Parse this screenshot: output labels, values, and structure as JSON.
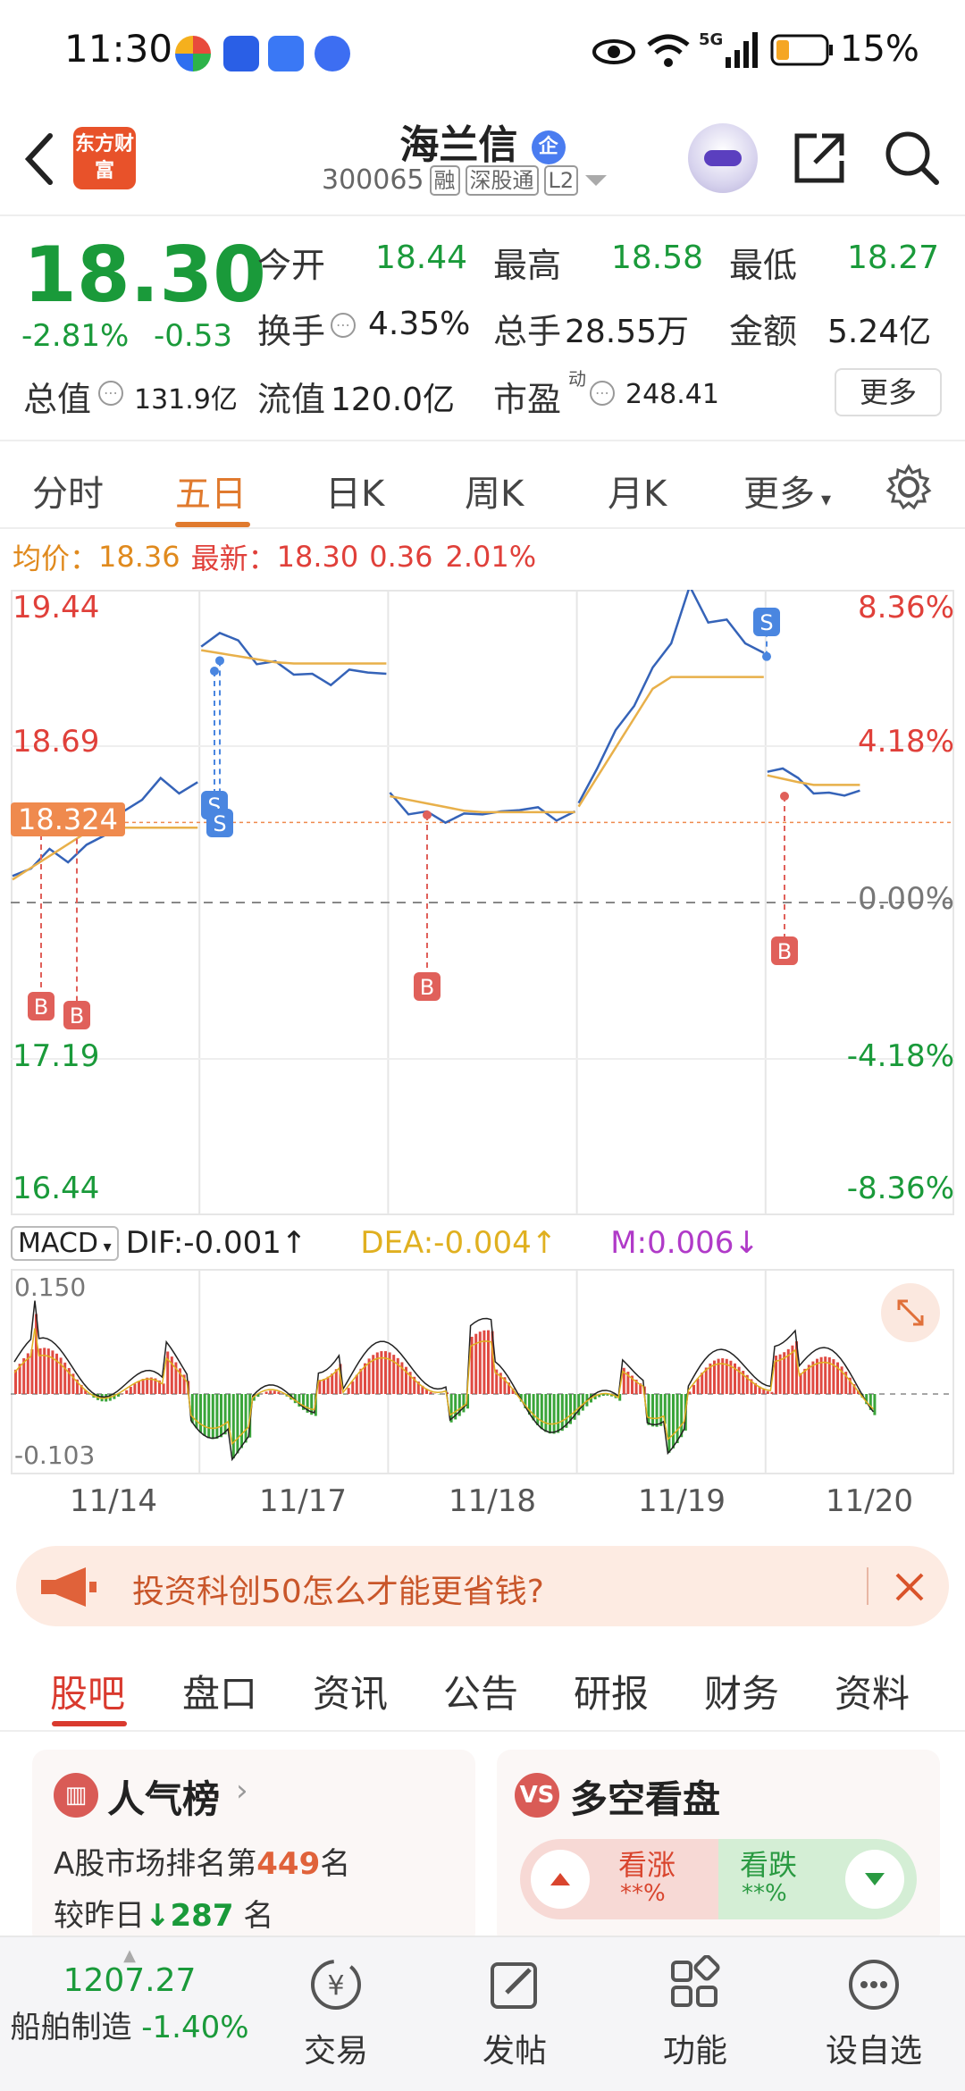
{
  "status_bar": {
    "time": "11:30",
    "signal": "5G",
    "battery": "15%"
  },
  "header": {
    "logo_text": "东方财富",
    "name": "海兰信",
    "badge": "企",
    "code": "300065",
    "tags": [
      "融",
      "深股通",
      "L2"
    ]
  },
  "quote": {
    "price": "18.30",
    "change_pct": "-2.81%",
    "change_amt": "-0.53",
    "open_label": "今开",
    "open": "18.44",
    "high_label": "最高",
    "high": "18.58",
    "low_label": "最低",
    "low": "18.27",
    "turnover_label": "换手",
    "turnover": "4.35%",
    "volume_label": "总手",
    "volume": "28.55万",
    "amount_label": "金额",
    "amount": "5.24亿",
    "mktcap_label": "总值",
    "mktcap": "131.9亿",
    "float_label": "流值",
    "float": "120.0亿",
    "pe_label": "市盈",
    "pe_sup": "动",
    "pe": "248.41",
    "more_label": "更多"
  },
  "chart_tabs": [
    "分时",
    "五日",
    "日K",
    "周K",
    "月K",
    "更多"
  ],
  "avg_line": {
    "avg_label": "均价：",
    "avg": "18.36",
    "latest_label": "最新：",
    "latest": "18.30",
    "diff": "0.36",
    "pct": "2.01%"
  },
  "chart_data": {
    "type": "line",
    "title": "",
    "y_left_ticks": [
      "19.44",
      "18.69",
      "17.19",
      "16.44"
    ],
    "y_right_ticks": [
      "8.36%",
      "4.18%",
      "0.00%",
      "-4.18%",
      "-8.36%"
    ],
    "current_marker": "18.324",
    "ylim": [
      16.44,
      19.44
    ],
    "x_days": [
      "11/14",
      "11/17",
      "11/18",
      "11/19",
      "11/20"
    ],
    "series": [
      {
        "values": [
          18.05,
          18.12,
          18.18,
          18.15,
          18.2,
          18.28,
          18.36,
          18.45,
          18.52,
          18.48,
          18.5,
          19.15,
          19.25,
          19.18,
          19.1,
          19.08,
          19.05,
          19.02,
          19.0,
          19.04,
          19.06,
          19.02,
          18.45,
          18.38,
          18.36,
          18.34,
          18.35,
          18.38,
          18.36,
          18.4,
          18.38,
          18.35,
          18.36,
          18.4,
          18.6,
          18.75,
          18.9,
          19.05,
          19.2,
          19.44,
          19.3,
          19.28,
          19.2,
          19.12,
          18.55,
          18.6,
          18.52,
          18.48,
          18.45,
          18.47,
          18.46
        ]
      }
    ],
    "trade_marks": [
      {
        "label": "B",
        "day": "11/14"
      },
      {
        "label": "B",
        "day": "11/14"
      },
      {
        "label": "S",
        "day": "11/17"
      },
      {
        "label": "S",
        "day": "11/17"
      },
      {
        "label": "B",
        "day": "11/18"
      },
      {
        "label": "S",
        "day": "11/19"
      },
      {
        "label": "B",
        "day": "11/20"
      }
    ]
  },
  "macd": {
    "label": "MACD",
    "dif": "DIF:-0.001",
    "dea": "DEA:-0.004",
    "m": "M:0.006",
    "max": "0.150",
    "min": "-0.103"
  },
  "ad": {
    "text": "投资科创50怎么才能更省钱?"
  },
  "bottom_tabs": [
    "股吧",
    "盘口",
    "资讯",
    "公告",
    "研报",
    "财务",
    "资料"
  ],
  "card_popular": {
    "title": "人气榜",
    "rank_prefix": "A股市场排名第",
    "rank": "449",
    "rank_suffix": "名",
    "cmp_prefix": "较昨日",
    "cmp": "287",
    "cmp_suffix": "名"
  },
  "card_sentiment": {
    "title": "多空看盘",
    "bull_label": "看涨",
    "bull_value": "**%",
    "bear_label": "看跌",
    "bear_value": "**%"
  },
  "bottom_nav": {
    "index_value": "1207.27",
    "index_name": "船舶制造",
    "index_change": "-1.40%",
    "items": [
      "交易",
      "发帖",
      "功能",
      "设自选"
    ]
  }
}
